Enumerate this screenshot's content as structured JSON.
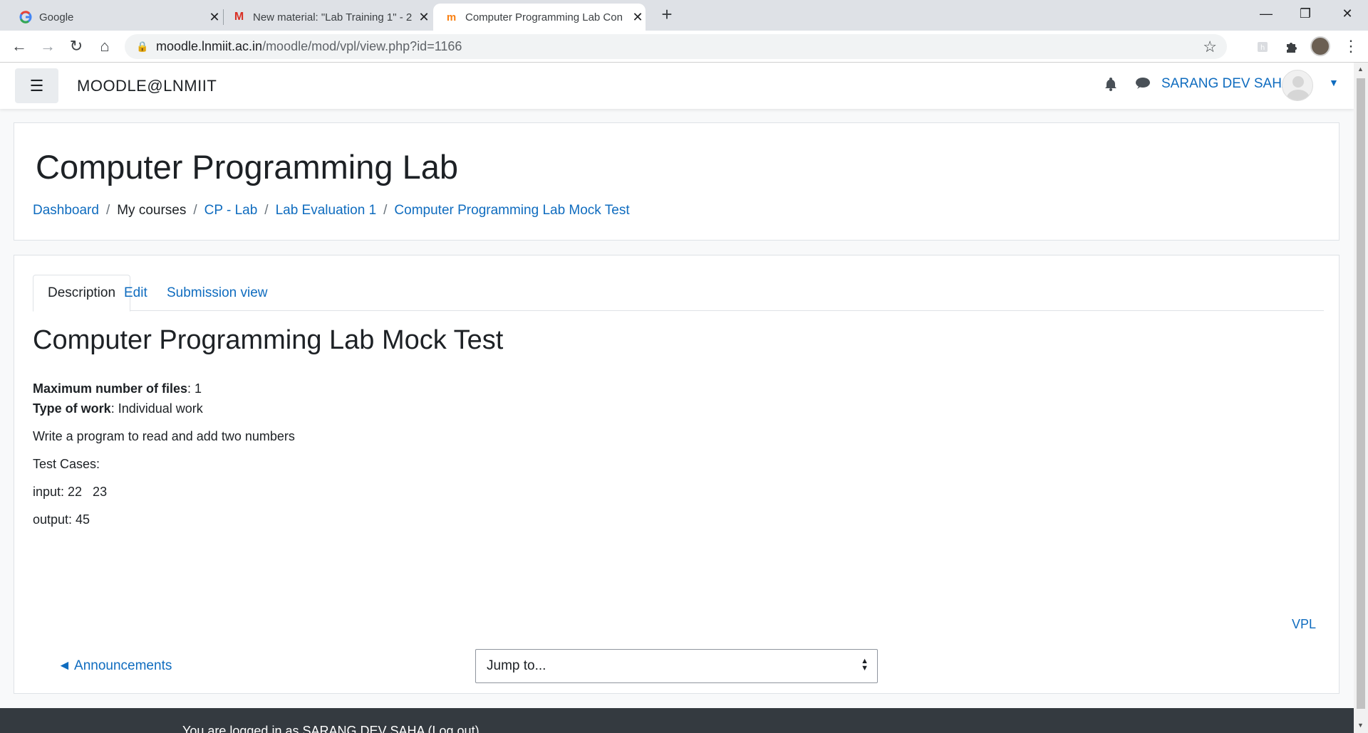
{
  "browser": {
    "tabs": [
      {
        "title": "Google",
        "favicon": "google-icon"
      },
      {
        "title": "New material: \"Lab Training 1\" - 2",
        "favicon": "gmail-icon"
      },
      {
        "title": "Computer Programming Lab Con",
        "favicon": "moodle-icon",
        "active": true
      }
    ],
    "url_host": "moodle.lnmiit.ac.in",
    "url_path": "/moodle/mod/vpl/view.php?id=1166"
  },
  "site": {
    "name": "MOODLE@LNMIIT",
    "user_name": "SARANG DEV SAHA"
  },
  "header": {
    "course_title": "Computer Programming Lab",
    "breadcrumb": [
      {
        "label": "Dashboard",
        "link": true
      },
      {
        "label": "My courses",
        "link": false
      },
      {
        "label": "CP - Lab",
        "link": true
      },
      {
        "label": "Lab Evaluation 1",
        "link": true
      },
      {
        "label": "Computer Programming Lab Mock Test",
        "link": true
      }
    ]
  },
  "activity": {
    "tabs": [
      "Description",
      "Edit",
      "Submission view"
    ],
    "title": "Computer Programming Lab Mock Test",
    "max_files_label": "Maximum number of files",
    "max_files_value": ": 1",
    "work_type_label": "Type of work",
    "work_type_value": ": Individual work",
    "description": "Write a program to read and add two numbers",
    "test_cases_label": "Test Cases:",
    "input_line": "input: 22   23",
    "output_line": "output: 45",
    "vpl_link": "VPL",
    "prev_activity": "◄ Announcements",
    "jump_to": "Jump to..."
  },
  "footer": {
    "logged_in_text": "You are logged in as SARANG DEV SAHA (Log out)"
  },
  "colors": {
    "link": "#0f6cbf",
    "footer_bg": "#343a40",
    "tabbar_bg": "#dee1e6"
  }
}
